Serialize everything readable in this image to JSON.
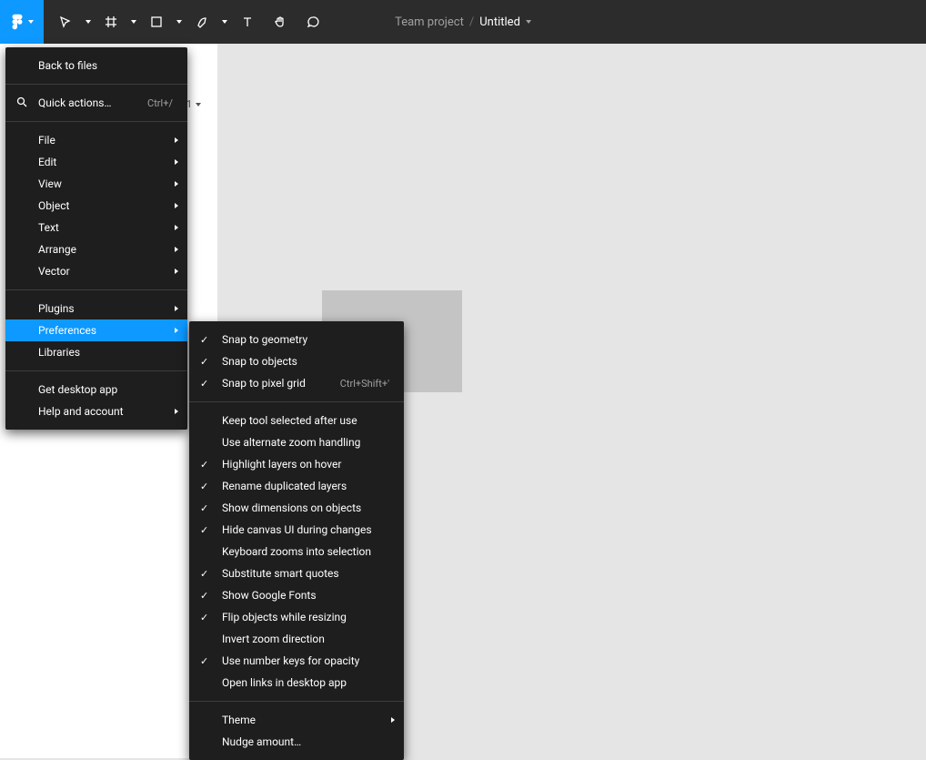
{
  "header": {
    "team": "Team project",
    "file": "Untitled"
  },
  "panel": {
    "zoom": "1"
  },
  "main_menu": {
    "back": "Back to files",
    "quick_actions": "Quick actions…",
    "quick_shortcut": "Ctrl+/",
    "file": "File",
    "edit": "Edit",
    "view": "View",
    "object": "Object",
    "text": "Text",
    "arrange": "Arrange",
    "vector": "Vector",
    "plugins": "Plugins",
    "preferences": "Preferences",
    "libraries": "Libraries",
    "get_desktop": "Get desktop app",
    "help": "Help and account"
  },
  "prefs": [
    {
      "label": "Snap to geometry",
      "checked": true
    },
    {
      "label": "Snap to objects",
      "checked": true
    },
    {
      "label": "Snap to pixel grid",
      "checked": true,
      "shortcut": "Ctrl+Shift+'"
    }
  ],
  "prefs2": [
    {
      "label": "Keep tool selected after use",
      "checked": false
    },
    {
      "label": "Use alternate zoom handling",
      "checked": false
    },
    {
      "label": "Highlight layers on hover",
      "checked": true
    },
    {
      "label": "Rename duplicated layers",
      "checked": true
    },
    {
      "label": "Show dimensions on objects",
      "checked": true
    },
    {
      "label": "Hide canvas UI during changes",
      "checked": true
    },
    {
      "label": "Keyboard zooms into selection",
      "checked": false
    },
    {
      "label": "Substitute smart quotes",
      "checked": true
    },
    {
      "label": "Show Google Fonts",
      "checked": true
    },
    {
      "label": "Flip objects while resizing",
      "checked": true
    },
    {
      "label": "Invert zoom direction",
      "checked": false
    },
    {
      "label": "Use number keys for opacity",
      "checked": true
    },
    {
      "label": "Open links in desktop app",
      "checked": false
    }
  ],
  "prefs3": {
    "theme": "Theme",
    "nudge": "Nudge amount…"
  }
}
